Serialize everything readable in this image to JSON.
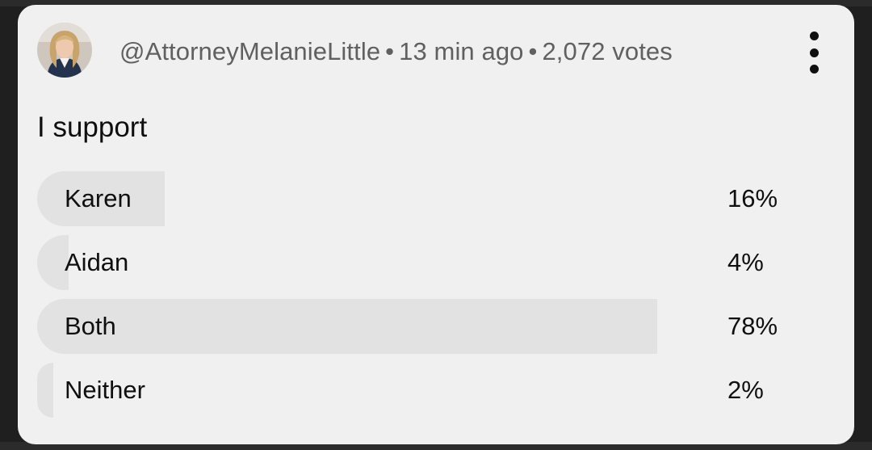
{
  "post": {
    "author": "@AttorneyMelanieLittle",
    "time": "13 min ago",
    "votes": "2,072 votes",
    "separator": "•"
  },
  "poll": {
    "question": "I support",
    "options": [
      {
        "label": "Karen",
        "percent_label": "16%",
        "percent": 16
      },
      {
        "label": "Aidan",
        "percent_label": "4%",
        "percent": 4
      },
      {
        "label": "Both",
        "percent_label": "78%",
        "percent": 78
      },
      {
        "label": "Neither",
        "percent_label": "2%",
        "percent": 2
      }
    ]
  },
  "icons": {
    "avatar": "avatar-photo",
    "menu": "more-vertical-icon"
  },
  "colors": {
    "card_bg": "#f0f0f0",
    "bar_fill": "#e2e2e2",
    "meta_text": "#606060",
    "primary_text": "#0f0f0f",
    "page_bg": "#1f1f1f"
  }
}
